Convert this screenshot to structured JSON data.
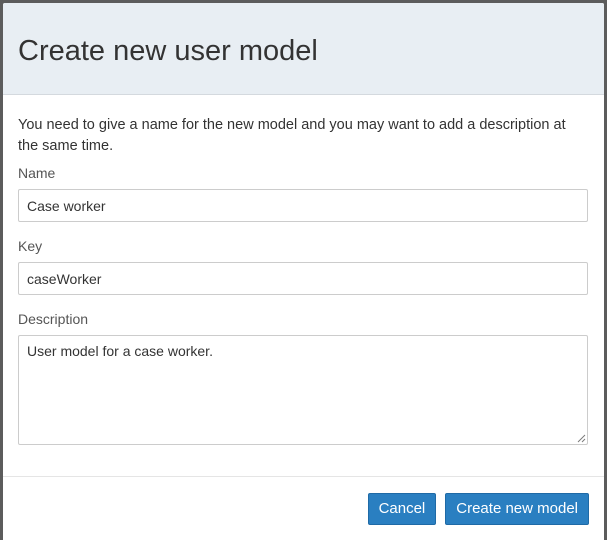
{
  "dialog": {
    "title": "Create new user model",
    "intro": "You need to give a name for the new model and you may want to add a description at the same time.",
    "fields": {
      "name": {
        "label": "Name",
        "value": "Case worker"
      },
      "key": {
        "label": "Key",
        "value": "caseWorker"
      },
      "description": {
        "label": "Description",
        "value": "User model for a case worker."
      }
    },
    "buttons": {
      "cancel": "Cancel",
      "create": "Create new model"
    }
  },
  "colors": {
    "header_bg": "#e8eef3",
    "primary_button": "#2a7fc1",
    "overlay": "#5c5c5c"
  }
}
